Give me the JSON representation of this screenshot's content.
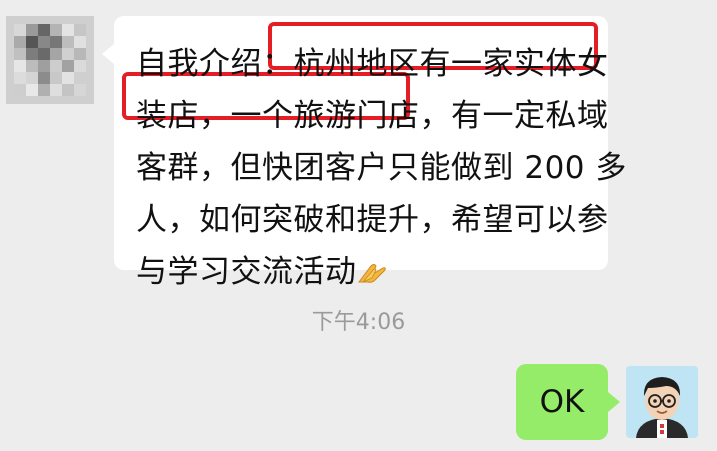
{
  "left_message": {
    "lines": [
      "自我介绍：杭州地区有一家实体女",
      "装店，一个旅游门店，有一定私域",
      "客群，但快团客户只能做到 200 多",
      "人，如何突破和提升，希望可以参",
      "与学习交流活动"
    ],
    "trailing_emoji_icon": "praying-hands-icon",
    "highlight_color": "#e51d25",
    "bubble_color": "#ffffff"
  },
  "timestamp": "下午4:06",
  "right_message": {
    "text": "OK",
    "bubble_color": "#95ec69"
  },
  "left_avatar": {
    "icon": "blurred-avatar-icon"
  },
  "right_avatar": {
    "icon": "cartoon-man-avatar-icon",
    "background": "#bfe5f5"
  }
}
